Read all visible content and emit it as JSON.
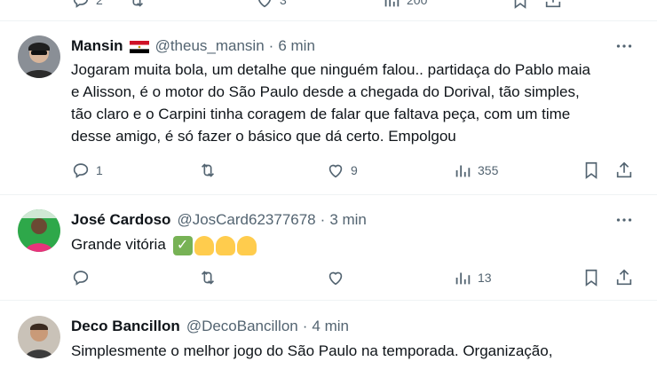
{
  "previous_tweet": {
    "actions": {
      "reply_count": "2",
      "like_count": "3",
      "view_count": "200"
    }
  },
  "tweets": [
    {
      "name": "Mansin",
      "handle": "@theus_mansin",
      "time": "6 min",
      "flag": "red-white-black-flag",
      "text_lines": [
        "Jogaram muita bola, um detalhe que ninguém falou.. partidaça do Pablo maia",
        "e Alisson, é o motor do São Paulo desde a chegada do Dorival, tão simples,",
        "tão claro e o Carpini tinha coragem de falar que faltava peça, com um time",
        "desse amigo, é só fazer o básico que dá certo. Empolgou"
      ],
      "reply_count": "1",
      "retweet_count": "",
      "like_count": "9",
      "view_count": "355"
    },
    {
      "name": "José Cardoso",
      "handle": "@JosCard62377678",
      "time": "3 min",
      "text_lines": [
        "Grande vitória"
      ],
      "emojis": [
        "check-mark-emoji",
        "clapping-hands-emoji",
        "clapping-hands-emoji",
        "clapping-hands-emoji"
      ],
      "reply_count": "",
      "retweet_count": "",
      "like_count": "",
      "view_count": "13"
    },
    {
      "name": "Deco Bancillon",
      "handle": "@DecoBancillon",
      "time": "4 min",
      "text_lines": [
        "Simplesmente o melhor jogo do São Paulo na temporada. Organização,"
      ]
    }
  ],
  "separator": "·",
  "colors": {
    "text": "#0f1419",
    "muted": "#536471",
    "divider": "#eff3f4"
  }
}
